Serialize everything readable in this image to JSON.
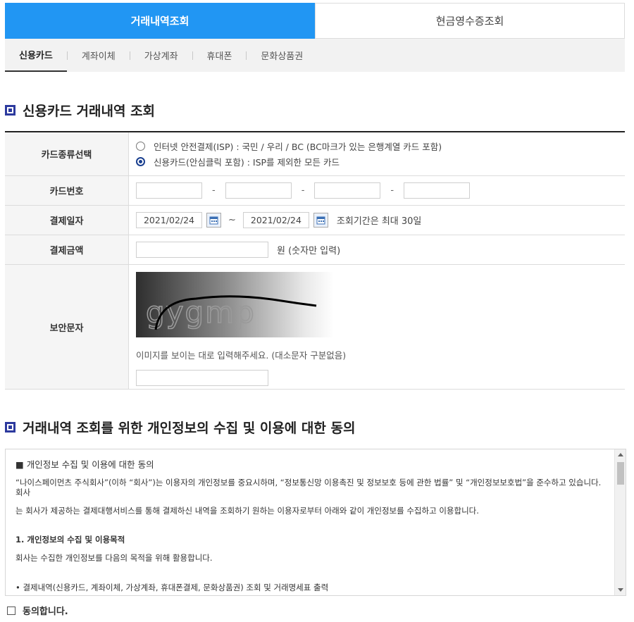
{
  "top_tabs": [
    {
      "label": "거래내역조회",
      "active": true
    },
    {
      "label": "현금영수증조회",
      "active": false
    }
  ],
  "sub_tabs": [
    {
      "label": "신용카드",
      "active": true
    },
    {
      "label": "계좌이체",
      "active": false
    },
    {
      "label": "가상계좌",
      "active": false
    },
    {
      "label": "휴대폰",
      "active": false
    },
    {
      "label": "문화상품권",
      "active": false
    }
  ],
  "section1_title": "신용카드 거래내역 조회",
  "form": {
    "card_type_label": "카드종류선택",
    "card_type_options": [
      {
        "label": "인터넷 안전결제(ISP) : 국민 / 우리 / BC (BC마크가 있는 은행계열 카드 포함)",
        "selected": false
      },
      {
        "label": "신용카드(안심클릭 포함) : ISP를 제외한 모든 카드",
        "selected": true
      }
    ],
    "card_number_label": "카드번호",
    "card_number_sep": "-",
    "pay_date_label": "결제일자",
    "date_from": "2021/02/24",
    "date_to": "2021/02/24",
    "date_tilde": "~",
    "date_note": "조회기간은 최대 30일",
    "amount_label": "결제금액",
    "amount_note": "원 (숫자만 입력)",
    "captcha_label": "보안문자",
    "captcha_text": "gygmp",
    "captcha_help": "이미지를 보이는 대로 입력해주세요. (대소문자 구분없음)"
  },
  "section2_title": "거래내역 조회를 위한 개인정보의 수집 및 이용에 대한 동의",
  "consent": {
    "heading": "■ 개인정보 수집 및 이용에 대한 동의",
    "para1_line1": "“나이스페이먼츠 주식회사”(이하 “회사”)는 이용자의 개인정보를 중요시하며, “정보통신망 이용촉진 및 정보보호 등에 관한 법률” 및 “개인정보보호법”을 준수하고 있습니다. 회사",
    "para1_line2": "는 회사가 제공하는 결제대행서비스를 통해 결제하신 내역을 조회하기 원하는 이용자로부터 아래와 같이 개인정보를 수집하고 이용합니다.",
    "sub1_title": "1. 개인정보의 수집 및 이용목적",
    "sub1_text": "회사는 수집한 개인정보를 다음의 목적을 위해 활용합니다.",
    "bullet1": "• 결제내역(신용카드, 계좌이체, 가상계좌, 휴대폰결제, 문화상품권) 조회 및 거래명세표 출력"
  },
  "agree_label": "동의합니다."
}
